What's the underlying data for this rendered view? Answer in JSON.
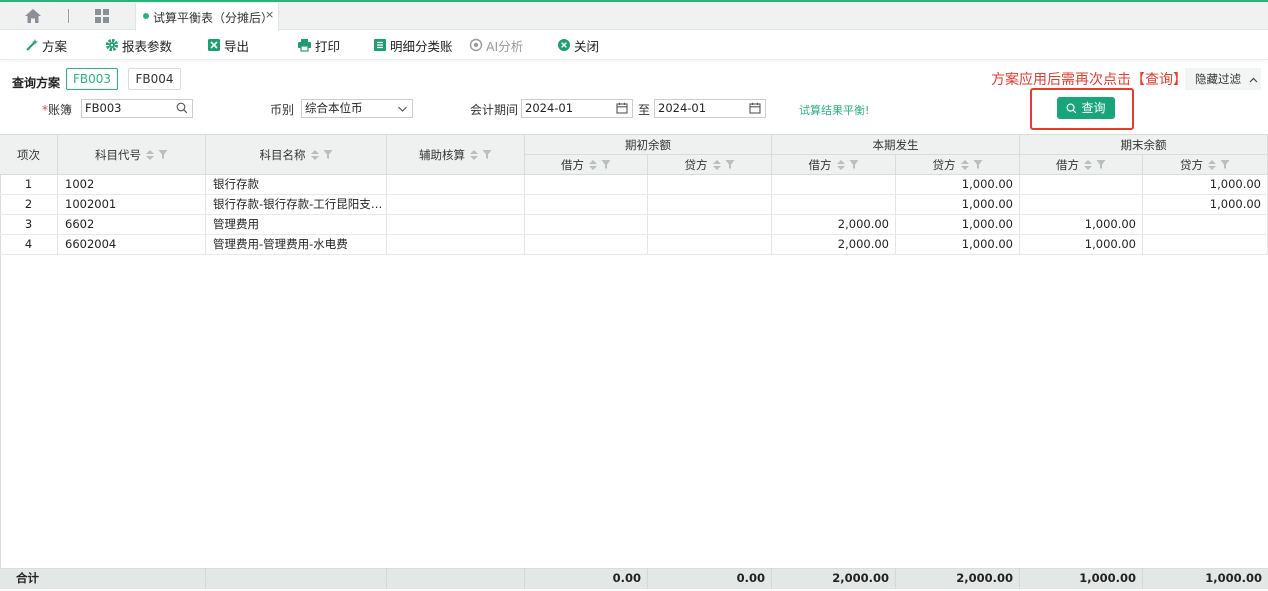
{
  "tab": {
    "title": "试算平衡表（分摊后）",
    "close": "×"
  },
  "toolbar": {
    "plan": "方案",
    "params": "报表参数",
    "export": "导出",
    "print": "打印",
    "detail": "明细分类账",
    "ai": "AI分析",
    "close": "关闭"
  },
  "filter": {
    "plan_label": "查询方案",
    "plans": [
      "FB003",
      "FB004"
    ],
    "required_mark": "*",
    "ledger_label": "账簿",
    "ledger_value": "FB003",
    "currency_label": "币别",
    "currency_value": "综合本位币",
    "period_label": "会计期间",
    "period_from": "2024-01",
    "period_to_label": "至",
    "period_to": "2024-01",
    "balance_text": "试算结果平衡!",
    "hint": "方案应用后需再次点击【查询】",
    "hide_filter": "隐藏过滤",
    "query_button": "查询"
  },
  "table": {
    "headers": {
      "index": "项次",
      "code": "科目代号",
      "name": "科目名称",
      "aux": "辅助核算",
      "opening": "期初余额",
      "period": "本期发生",
      "closing": "期末余额",
      "debit": "借方",
      "credit": "贷方"
    },
    "rows": [
      {
        "index": "1",
        "code": "1002",
        "name": "银行存款",
        "aux": "",
        "open_d": "",
        "open_c": "",
        "per_d": "",
        "per_c": "1,000.00",
        "close_d": "",
        "close_c": "1,000.00"
      },
      {
        "index": "2",
        "code": "1002001",
        "name": "银行存款-银行存款-工行昆阳支行...",
        "aux": "",
        "open_d": "",
        "open_c": "",
        "per_d": "",
        "per_c": "1,000.00",
        "close_d": "",
        "close_c": "1,000.00"
      },
      {
        "index": "3",
        "code": "6602",
        "name": "管理费用",
        "aux": "",
        "open_d": "",
        "open_c": "",
        "per_d": "2,000.00",
        "per_c": "1,000.00",
        "close_d": "1,000.00",
        "close_c": ""
      },
      {
        "index": "4",
        "code": "6602004",
        "name": "管理费用-管理费用-水电费",
        "aux": "",
        "open_d": "",
        "open_c": "",
        "per_d": "2,000.00",
        "per_c": "1,000.00",
        "close_d": "1,000.00",
        "close_c": ""
      }
    ],
    "footer": {
      "label": "合计",
      "open_d": "0.00",
      "open_c": "0.00",
      "per_d": "2,000.00",
      "per_c": "2,000.00",
      "close_d": "1,000.00",
      "close_c": "1,000.00"
    }
  },
  "colors": {
    "accent": "#2bb27a",
    "button": "#17a579",
    "hint": "#e83a2e"
  }
}
